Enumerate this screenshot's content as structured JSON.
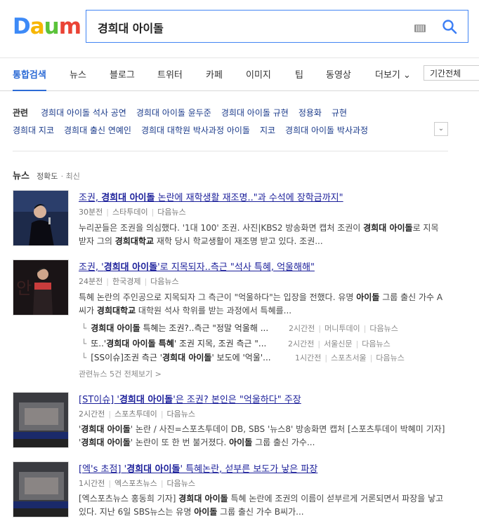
{
  "logo": {
    "letters": [
      "D",
      "a",
      "u",
      "m"
    ],
    "colors": [
      "#3d8af7",
      "#f7b600",
      "#5bc33a",
      "#ea4335"
    ]
  },
  "search": {
    "value": "경희대 아이돌"
  },
  "tabs": [
    {
      "label": "통합검색",
      "active": true
    },
    {
      "label": "뉴스"
    },
    {
      "label": "블로그"
    },
    {
      "label": "트위터"
    },
    {
      "label": "카페"
    },
    {
      "label": "이미지"
    },
    {
      "label": "팁"
    },
    {
      "label": "동영상"
    },
    {
      "label": "더보기 ⌄"
    }
  ],
  "period": "기간전체",
  "related": {
    "label": "관련",
    "row1": [
      "경희대 아이돌 석사 공연",
      "경희대 아이돌 윤두준",
      "경희대 아이돌 규현",
      "정용화",
      "규현"
    ],
    "row2": [
      "경희대 지코",
      "경희대 출신 연예인",
      "경희대 대학원 박사과정 아이돌",
      "지코",
      "경희대 아이돌 박사과정"
    ]
  },
  "news": {
    "title": "뉴스",
    "sort_active": "정확도",
    "sort_other": "최신",
    "items": [
      {
        "title_a": "조권, ",
        "title_b": "경희대 아이돌",
        "title_c": " 논란에 재학생활 재조명..\"과 수석에 장학금까지\"",
        "time": "30분전",
        "source": "스타투데이",
        "via": "다음뉴스",
        "desc_a": "누리꾼들은 조권을 의심했다. '1대 100' 조권. 사진|KBS2 방송화면 캡처 조권이 ",
        "desc_b": "경희대 아이돌",
        "desc_c": "로 지목 받자 그의 ",
        "desc_d": "경희대학교",
        "desc_e": " 재학 당시 학교생활이 재조명 받고 있다. 조권..."
      },
      {
        "title_a": "조권, '",
        "title_b": "경희대 아이돌",
        "title_c": "'로 지목되자..측근 \"석사 특혜, 억울해해\"",
        "time": "24분전",
        "source": "한국경제",
        "via": "다음뉴스",
        "desc_a": "특혜 논란의 주인공으로 지목되자 그 측근이 \"억울하다\"는 입장을 전했다. 유명 ",
        "desc_b": "아이돌",
        "desc_c": " 그룹 출신 가수 A씨가 ",
        "desc_d": "경희대학교",
        "desc_e": " 대학원 석사 학위를 받는 과정에서 특혜를...",
        "subs": [
          {
            "a": "",
            "b": "경희대 아이돌",
            "c": " 특혜는 조권?..측근 \"정말 억울해 ...",
            "time": "2시간전",
            "source": "머니투데이",
            "via": "다음뉴스"
          },
          {
            "a": "또..'",
            "b": "경희대 아이돌 특혜",
            "c": "' 조권 지목, 조권 측근 \"...",
            "time": "2시간전",
            "source": "서울신문",
            "via": "다음뉴스"
          },
          {
            "a": "[SS이슈]조권 측근 '",
            "b": "경희대 아이돌",
            "c": "' 보도에 '억울'...",
            "time": "1시간전",
            "source": "스포츠서울",
            "via": "다음뉴스"
          }
        ],
        "related_more": "관련뉴스 5건 전체보기 >"
      },
      {
        "title_a": "[ST이슈] '",
        "title_b": "경희대 아이돌",
        "title_c": "'은 조권? 본인은 \"억울하다\" 주장",
        "time": "2시간전",
        "source": "스포츠투데이",
        "via": "다음뉴스",
        "desc_a": "'",
        "desc_b": "경희대 아이돌",
        "desc_c": "' 논란 / 사진=스포츠투데이 DB, SBS '뉴스8' 방송화면 캡처 [스포츠투데이 박혜미 기자] '",
        "desc_d": "경희대 아이돌",
        "desc_e": "' 논란이 또 한 번 불거졌다. ",
        "desc_f": "아이돌",
        "desc_g": " 그룹 출신 가수..."
      },
      {
        "title_a": "[엑's 초점] '",
        "title_b": "경희대 아이돌",
        "title_c": "' 특혜논란, 섣부른 보도가 낳은 파장",
        "time": "1시간전",
        "source": "엑스포츠뉴스",
        "via": "다음뉴스",
        "desc_a": "[엑스포츠뉴스 홍동희 기자] ",
        "desc_b": "경희대 아이돌",
        "desc_c": " 특혜 논란에 조권의 이름이 섣부르게 거론되면서 파장을 낳고 있다. 지난 6일 SBS뉴스는 유명 ",
        "desc_d": "아이돌",
        "desc_e": " 그룹 출신 가수 B씨가..."
      }
    ]
  }
}
